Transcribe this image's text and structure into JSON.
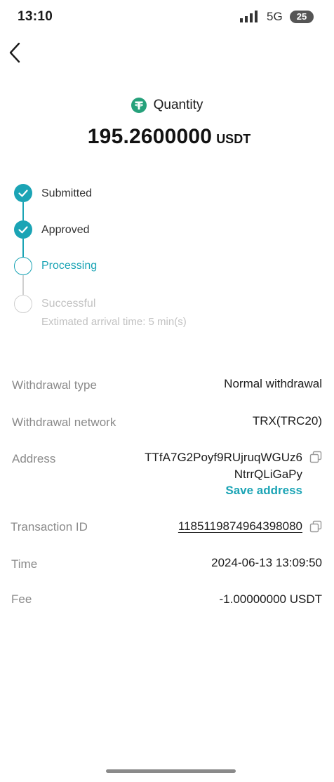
{
  "status_bar": {
    "time": "13:10",
    "network": "5G",
    "battery": "25"
  },
  "header": {
    "quantity_label": "Quantity",
    "amount": "195.2600000",
    "unit": "USDT",
    "coin_icon": "tether-icon"
  },
  "steps": [
    {
      "label": "Submitted",
      "state": "done"
    },
    {
      "label": "Approved",
      "state": "done"
    },
    {
      "label": "Processing",
      "state": "current"
    },
    {
      "label": "Successful",
      "state": "pending",
      "sub": "Extimated arrival time: 5 min(s)"
    }
  ],
  "details": {
    "withdrawal_type": {
      "label": "Withdrawal type",
      "value": "Normal withdrawal"
    },
    "withdrawal_network": {
      "label": "Withdrawal network",
      "value": "TRX(TRC20)"
    },
    "address": {
      "label": "Address",
      "line1": "TTfA7G2Poyf9RUjruqWGUz6",
      "line2": "NtrrQLiGaPy",
      "save_label": "Save address"
    },
    "transaction_id": {
      "label": "Transaction ID",
      "value": "1185119874964398080"
    },
    "time": {
      "label": "Time",
      "value": "2024-06-13 13:09:50"
    },
    "fee": {
      "label": "Fee",
      "value": "-1.00000000 USDT"
    }
  },
  "colors": {
    "accent": "#1ba4b5",
    "tether": "#26a17b",
    "muted": "#8a8a8a",
    "disabled": "#c2c2c2"
  }
}
